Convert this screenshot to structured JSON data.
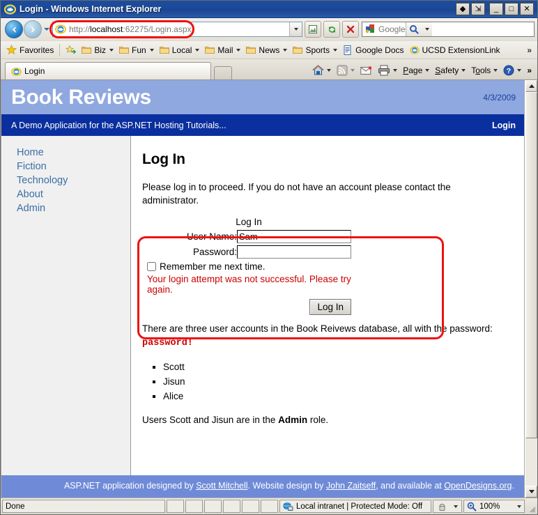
{
  "browser": {
    "window_title": "Login - Windows Internet Explorer",
    "window_buttons": [
      "restore-group",
      "restore-window",
      "minimize",
      "maximize",
      "close"
    ],
    "address": {
      "protocol": "http://",
      "host": "localhost",
      "rest": ":62275/Login.aspx",
      "full": "http://localhost:62275/Login.aspx"
    },
    "search": {
      "provider": "Google",
      "placeholder": "Google"
    },
    "favorites_bar": {
      "favorites_label": "Favorites",
      "items": [
        {
          "label": "Biz",
          "icon": "folder-icon",
          "has_menu": true
        },
        {
          "label": "Fun",
          "icon": "folder-icon",
          "has_menu": true
        },
        {
          "label": "Local",
          "icon": "folder-icon",
          "has_menu": true
        },
        {
          "label": "Mail",
          "icon": "folder-icon",
          "has_menu": true
        },
        {
          "label": "News",
          "icon": "folder-icon",
          "has_menu": true
        },
        {
          "label": "Sports",
          "icon": "folder-icon",
          "has_menu": true
        },
        {
          "label": "Google Docs",
          "icon": "document-icon",
          "has_menu": false
        },
        {
          "label": "UCSD ExtensionLink",
          "icon": "ie-icon",
          "has_menu": false
        }
      ],
      "overflow": "»"
    },
    "tabs": [
      {
        "label": "Login",
        "active": true
      }
    ],
    "command_bar": {
      "items": [
        {
          "label": "Page",
          "accesskey": "P"
        },
        {
          "label": "Safety",
          "accesskey": "S"
        },
        {
          "label": "Tools",
          "accesskey": "o"
        }
      ],
      "overflow": "»"
    },
    "status_bar": {
      "status": "Done",
      "zone": "Local intranet | Protected Mode: Off",
      "zoom": "100%"
    }
  },
  "site": {
    "banner_title": "Book Reviews",
    "date": "4/3/2009",
    "tagline": "A Demo Application for the ASP.NET Hosting Tutorials...",
    "login_link": "Login",
    "nav": [
      {
        "label": "Home"
      },
      {
        "label": "Fiction"
      },
      {
        "label": "Technology"
      },
      {
        "label": "About"
      },
      {
        "label": "Admin"
      }
    ],
    "content": {
      "heading": "Log In",
      "intro": "Please log in to proceed. If you do not have an account please contact the administrator.",
      "login_form": {
        "title": "Log In",
        "username_label": "User Name:",
        "username_value": "Sam",
        "password_label": "Password:",
        "password_value": "",
        "remember_label": "Remember me next time.",
        "remember_checked": false,
        "error": "Your login attempt was not successful. Please try again.",
        "submit_label": "Log In"
      },
      "accounts_text_before": "There are three user accounts in the Book Reivews database, all with the password: ",
      "accounts_password": "password!",
      "accounts": [
        "Scott",
        "Jisun",
        "Alice"
      ],
      "roles_before": "Users Scott and Jisun are in the ",
      "roles_bold": "Admin",
      "roles_after": " role."
    },
    "footer": {
      "part1": "ASP.NET application designed by ",
      "link1": "Scott Mitchell",
      "part2": ". Website design by ",
      "link2": "John Zaitseff",
      "part3": ", and available at ",
      "link3": "OpenDesigns.org",
      "part4": "."
    }
  },
  "colors": {
    "banner": "#8fa8e0",
    "subbanner": "#0a2f9e",
    "footer": "#6f8bd8",
    "link": "#3a6ea5",
    "error": "#cc0000",
    "annotation": "#ee1111"
  }
}
